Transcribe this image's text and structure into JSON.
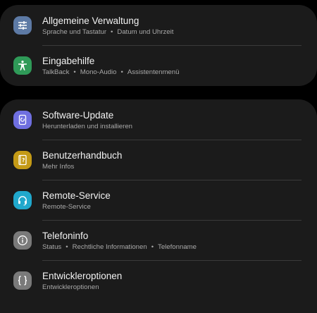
{
  "colors": {
    "background": "#000000",
    "card": "#1b1b1b",
    "title": "#f2f2f2",
    "subtitle": "#a9a9a9",
    "divider": "#3a3a3a"
  },
  "group1": {
    "items": [
      {
        "title": "Allgemeine Verwaltung",
        "subs": [
          "Sprache und Tastatur",
          "Datum und Uhrzeit"
        ],
        "icon": "sliders-icon",
        "icon_color": "#5d7aa5"
      },
      {
        "title": "Eingabehilfe",
        "subs": [
          "TalkBack",
          "Mono-Audio",
          "Assistentenmenü"
        ],
        "icon": "accessibility-person-icon",
        "icon_color": "#2f9a58"
      }
    ]
  },
  "group2": {
    "items": [
      {
        "title": "Software-Update",
        "subs": [
          "Herunterladen und installieren"
        ],
        "icon": "software-update-icon",
        "icon_color": "#6f6fe0"
      },
      {
        "title": "Benutzerhandbuch",
        "subs": [
          "Mehr Infos"
        ],
        "icon": "user-manual-icon",
        "icon_color": "#c49a16"
      },
      {
        "title": "Remote-Service",
        "subs": [
          "Remote-Service"
        ],
        "icon": "headset-icon",
        "icon_color": "#20a8cc"
      },
      {
        "title": "Telefoninfo",
        "subs": [
          "Status",
          "Rechtliche Informationen",
          "Telefonname"
        ],
        "icon": "info-icon",
        "icon_color": "#7a7a7a"
      },
      {
        "title": "Entwickleroptionen",
        "subs": [
          "Entwickleroptionen"
        ],
        "icon": "braces-icon",
        "icon_color": "#7a7a7a"
      }
    ]
  }
}
